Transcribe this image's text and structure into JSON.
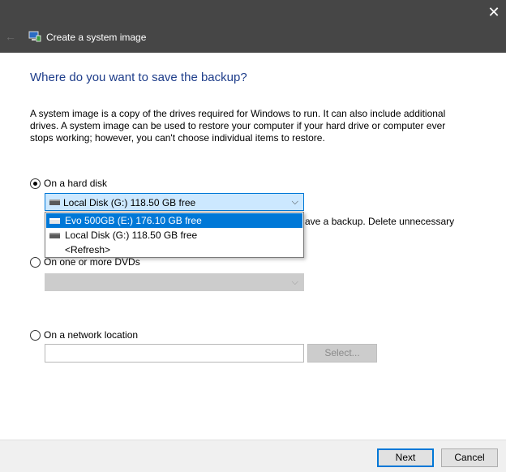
{
  "window": {
    "title": "Create a system image",
    "close_symbol": "✕",
    "back_symbol": "←"
  },
  "main": {
    "heading": "Where do you want to save the backup?",
    "description": "A system image is a copy of the drives required for Windows to run. It can also include additional drives. A system image can be used to restore your computer if your hard drive or computer ever stops working; however, you can't choose individual items to restore."
  },
  "hard_disk": {
    "label": "On a hard disk",
    "checked": true,
    "selected_value": "Local Disk (G:)  118.50 GB free",
    "options": [
      {
        "label": "Evo 500GB (E:)  176.10 GB free",
        "highlighted": true
      },
      {
        "label": "Local Disk (G:)  118.50 GB free",
        "highlighted": false
      },
      {
        "label": "<Refresh>",
        "highlighted": false
      }
    ],
    "obscured_text": "ave a backup. Delete unnecessary"
  },
  "dvds": {
    "label": "On one or more DVDs",
    "checked": false
  },
  "network": {
    "label": "On a network location",
    "checked": false,
    "input_value": "",
    "select_label": "Select..."
  },
  "footer": {
    "next_label": "Next",
    "cancel_label": "Cancel"
  },
  "colors": {
    "titlebar": "#464646",
    "heading": "#1e3d8a",
    "accent": "#0078d7",
    "combo_active_bg": "#cce8ff"
  }
}
